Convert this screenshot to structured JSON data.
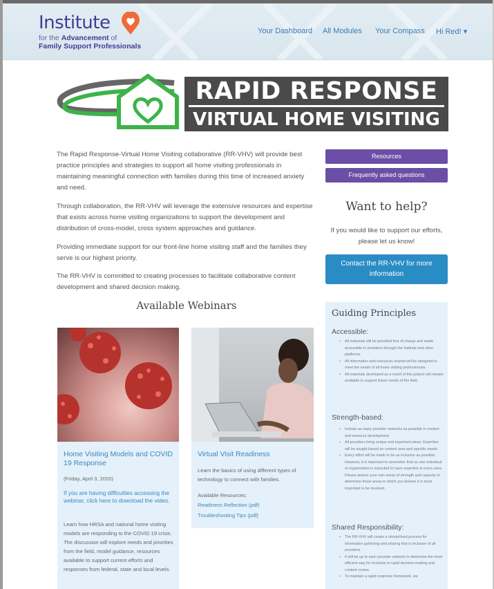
{
  "header": {
    "logo_title": "Institute",
    "logo_sub_pre": "for the ",
    "logo_sub_bold": "Advancement",
    "logo_sub_post": " of",
    "logo_sub2": "Family Support Professionals",
    "nav": [
      "Your Dashboard",
      "All Modules",
      "Your Compass",
      "Hi Red! ▾"
    ]
  },
  "banner": {
    "line1": "RAPID RESPONSE",
    "line2": "VIRTUAL HOME VISITING",
    "colors": {
      "green": "#3db34a",
      "dark": "#4a4a4a"
    }
  },
  "intro": [
    "The Rapid Response-Virtual Home Visiting collaborative (RR-VHV) will provide best practice principles and strategies to support all home visiting professionals in maintaining meaningful connection with families during this time of increased anxiety and need.",
    "Through collaboration, the RR-VHV will leverage the extensive resources and expertise that exists across home visiting organizations to support the development and distribution of cross-model, cross system approaches and guidance.",
    "Providing immediate support for our front-line home visiting staff and the families they serve is our highest priority.",
    "The RR-VHV is committed to creating processes to facilitate collaborative content development and shared decision making."
  ],
  "sidebar": {
    "resources_button": "Resources",
    "faq_button": "Frequently asked questions",
    "help_title": "Want to help?",
    "help_text": "If you would like to support our efforts, please let us know!",
    "contact_button": "Contact the RR-VHV for more information"
  },
  "webinars": {
    "title": "Available Webinars",
    "cards": [
      {
        "title": "Home Visiting Models and COVID 19 Response",
        "date": "(Friday, April 3, 2020)",
        "link": "If you are having difficulties accessing the webinar, click here to download the video.",
        "body": "Learn how HRSA and national home visiting models are responding to the COVID 19 crisis. The discussion will explore needs and priorities from the field, model guidance, resources available to support current efforts and responses from federal, state and local levels."
      },
      {
        "title": "Virtual Visit Readiness",
        "body": "Learn the basics of using different types of technology to connect with families.",
        "resources_label": "Available Resources:",
        "resource_links": [
          "Readiness Reflection (pdf)",
          "Troubleshooting Tips (pdf)"
        ]
      }
    ]
  },
  "principles": {
    "title": "Guiding Principles",
    "sections": [
      {
        "heading": "Accessible:",
        "items": [
          "All materials will be provided free of charge and made accessible to providers through the Institute and other platforms.",
          "All information and resources shared will be designed to meet the needs of all home visiting professionals.",
          "All materials developed as a result of this project will remain available to support future needs of the field."
        ]
      },
      {
        "heading": "Strength-based:",
        "items": [
          "Include as many provider networks as possible in content and resource development.",
          "All providers bring unique and important views. Expertise will be sought based on content area and specific needs.",
          "Every effort will be made to be as inclusive as possible. However, it is important to remember that no one individual or organization is expected to have expertise in every area. Please assess your own areas of strength and capacity to determine those areas in which you believe it is most important to be involved."
        ]
      },
      {
        "heading": "Shared Responsibility:",
        "items": [
          "The RR-VHV will create a streamlined process for information gathering and sharing that is inclusive of all providers.",
          "It will be up to each provider network to determine the most efficient way for inclusion in rapid decision-making and content review.",
          "To maintain a rapid response framework, we"
        ]
      }
    ]
  }
}
